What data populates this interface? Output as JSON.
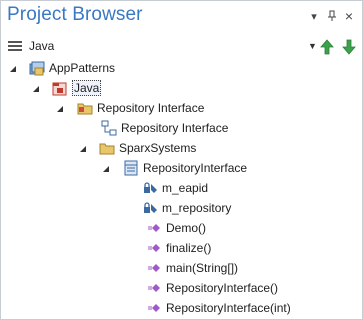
{
  "panel": {
    "title": "Project Browser",
    "controls": {
      "dropdown": "▾",
      "pin": "⊥",
      "close": "×"
    }
  },
  "toolbar": {
    "label": "Java"
  },
  "tree": {
    "root": {
      "label": "AppPatterns"
    },
    "java": {
      "label": "Java"
    },
    "repo_iface_pkg": {
      "label": "Repository Interface"
    },
    "repo_iface_diagram": {
      "label": "Repository Interface"
    },
    "sparx": {
      "label": "SparxSystems"
    },
    "repo_class": {
      "label": "RepositoryInterface"
    },
    "attributes": [
      {
        "label": "m_eapid"
      },
      {
        "label": "m_repository"
      }
    ],
    "operations": [
      {
        "label": "Demo()"
      },
      {
        "label": "finalize()"
      },
      {
        "label": "main(String[])"
      },
      {
        "label": "RepositoryInterface()"
      },
      {
        "label": "RepositoryInterface(int)"
      }
    ]
  },
  "colors": {
    "title": "#3a78c3",
    "arrow_green": "#3aa24a",
    "folder": "#e8c66a",
    "package_red": "#c0392b",
    "method_purple": "#a05ac8"
  }
}
